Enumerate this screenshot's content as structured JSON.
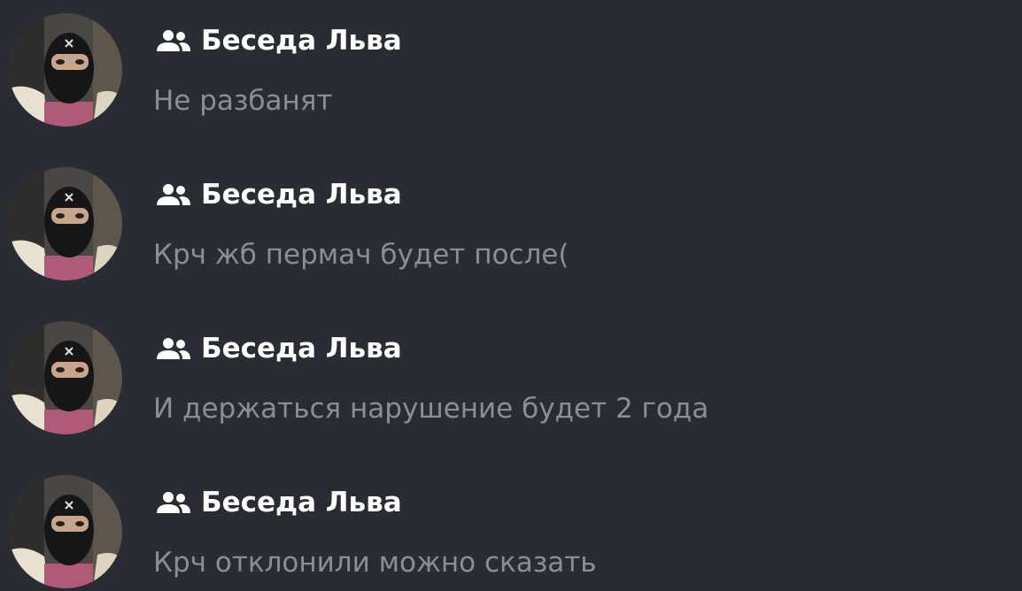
{
  "colors": {
    "background": "#292c33",
    "title": "#ffffff",
    "preview": "#8a8e96"
  },
  "icons": {
    "group": "group-users-icon"
  },
  "conversations": [
    {
      "title": "Беседа Льва",
      "last_message": "Не разбанят"
    },
    {
      "title": "Беседа Льва",
      "last_message": "Крч жб пермач будет после("
    },
    {
      "title": "Беседа Льва",
      "last_message": "И держаться нарушение будет 2 года"
    },
    {
      "title": "Беседа Льва",
      "last_message": "Крч отклонили можно сказать"
    }
  ]
}
